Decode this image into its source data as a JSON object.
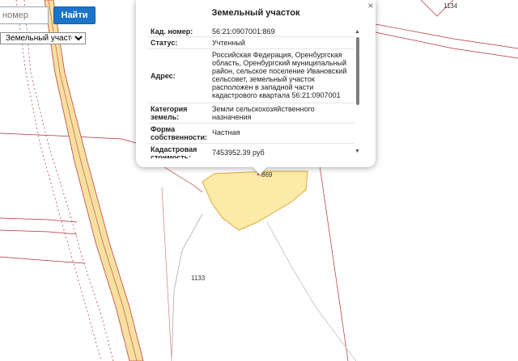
{
  "search": {
    "placeholder": "номер",
    "button_label": "Найти"
  },
  "layer_select": {
    "selected": "Земельный участок"
  },
  "map": {
    "labels": {
      "parcel_1134": "1134",
      "parcel_1133": "1133",
      "parcel_869": "869"
    },
    "colors": {
      "parcel_fill": "#fbe69a",
      "parcel_stroke": "#e0a93a",
      "boundary": "#b0303a",
      "road_fill": "#f5e0a0",
      "road_edge": "#c94040"
    }
  },
  "popup": {
    "title": "Земельный участок",
    "rows": [
      {
        "label": "Кад. номер:",
        "value": "56:21:0907001:869"
      },
      {
        "label": "Статус:",
        "value": "Учтенный"
      },
      {
        "label": "Адрес:",
        "value": "Российская Федерация, Оренбургская область, Оренбургский муниципальный район, сельское поселение Ивановский сельсовет, земельный участок расположен в западной части кадастрового квартала 56:21:0907001"
      },
      {
        "label": "Категория земель:",
        "value": "Земли сельскохозяйственного назначения"
      },
      {
        "label": "Форма собственности:",
        "value": "Частная"
      },
      {
        "label": "Кадастровая стоимость:",
        "value": "7453952.39 руб"
      }
    ]
  }
}
